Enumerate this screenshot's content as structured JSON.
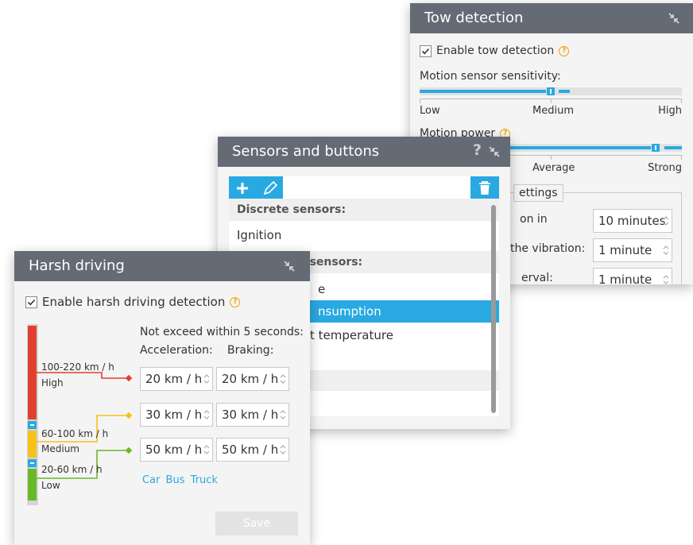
{
  "tow": {
    "title": "Tow detection",
    "enable_label": "Enable tow detection",
    "sensitivity_label": "Motion sensor sensitivity:",
    "sensitivity_low": "Low",
    "sensitivity_medium": "Medium",
    "sensitivity_high": "High",
    "sensitivity_level": 0.5,
    "power_label": "Motion power",
    "power_average": "Average",
    "power_strong": "Strong",
    "power_level": 0.9,
    "settings_legend": "ettings",
    "row1_label": "on in",
    "row1_value": "10 minutes",
    "row2_label": "the vibration:",
    "row2_value": "1 minute",
    "row3_label": "erval:",
    "row3_value": "1 minute"
  },
  "sensors": {
    "title": "Sensors and buttons",
    "help_glyph": "?",
    "list": [
      {
        "text": "Discrete sensors:",
        "kind": "header"
      },
      {
        "text": "Ignition",
        "kind": "item"
      },
      {
        "text": "t sensors:",
        "kind": "header"
      },
      {
        "text": "e",
        "kind": "item"
      },
      {
        "text": "nsumption",
        "kind": "selected"
      },
      {
        "text": "t temperature",
        "kind": "item"
      }
    ]
  },
  "harsh": {
    "title": "Harsh driving",
    "enable_label": "Enable harsh driving detection",
    "heading": "Not exceed within 5 seconds:",
    "col_accel": "Acceleration:",
    "col_brake": "Braking:",
    "levels": [
      {
        "range": "100-220 km / h",
        "name": "High",
        "accel": "20 km / h",
        "brake": "20 km / h",
        "color": "#e2402f"
      },
      {
        "range": "60-100 km / h",
        "name": "Medium",
        "accel": "30 km / h",
        "brake": "30 km / h",
        "color": "#f6c21a"
      },
      {
        "range": "20-60 km / h",
        "name": "Low",
        "accel": "50 km / h",
        "brake": "50 km / h",
        "color": "#69b829"
      }
    ],
    "presets": [
      "Car",
      "Bus",
      "Truck"
    ],
    "save_label": "Save",
    "accent": "#29a9e1"
  }
}
